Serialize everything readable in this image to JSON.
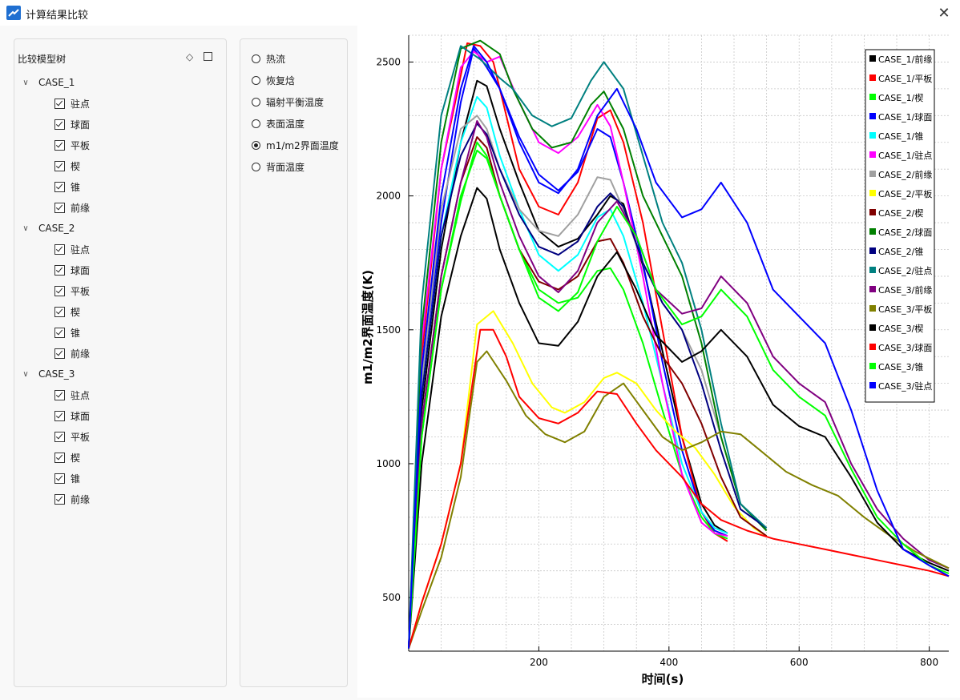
{
  "window": {
    "title": "计算结果比较",
    "close_glyph": "✕"
  },
  "tree": {
    "header": "比较模型树",
    "cases": [
      {
        "name": "CASE_1",
        "items": [
          "驻点",
          "球面",
          "平板",
          "楔",
          "锥",
          "前缘"
        ]
      },
      {
        "name": "CASE_2",
        "items": [
          "驻点",
          "球面",
          "平板",
          "楔",
          "锥",
          "前缘"
        ]
      },
      {
        "name": "CASE_3",
        "items": [
          "驻点",
          "球面",
          "平板",
          "楔",
          "锥",
          "前缘"
        ]
      }
    ]
  },
  "quantities": {
    "options": [
      "热流",
      "恢复焓",
      "辐射平衡温度",
      "表面温度",
      "m1/m2界面温度",
      "背面温度"
    ],
    "selected_index": 4
  },
  "chart_data": {
    "type": "line",
    "xlabel": "时间(s)",
    "ylabel": "m1/m2界面温度(K)",
    "xlim": [
      0,
      830
    ],
    "ylim": [
      300,
      2600
    ],
    "xticks": [
      200,
      400,
      600,
      800
    ],
    "yticks": [
      500,
      1000,
      1500,
      2000,
      2500
    ],
    "grid": true,
    "legend_position": "top-right",
    "series": [
      {
        "name": "CASE_1/前缘",
        "color": "#000000",
        "x": [
          0,
          20,
          50,
          80,
          105,
          120,
          140,
          170,
          200,
          230,
          260,
          290,
          310,
          330,
          360,
          390,
          420,
          450,
          470,
          490
        ],
        "y": [
          310,
          1200,
          1800,
          2200,
          2430,
          2410,
          2250,
          2050,
          1870,
          1810,
          1840,
          1930,
          2000,
          1970,
          1740,
          1420,
          1100,
          850,
          770,
          740
        ]
      },
      {
        "name": "CASE_1/平板",
        "color": "#ff0000",
        "x": [
          0,
          20,
          50,
          80,
          90,
          110,
          130,
          150,
          170,
          200,
          230,
          260,
          290,
          310,
          330,
          360,
          390,
          420,
          450,
          470,
          490
        ],
        "y": [
          310,
          1400,
          2100,
          2450,
          2570,
          2560,
          2500,
          2300,
          2100,
          1960,
          1930,
          2050,
          2290,
          2320,
          2200,
          1900,
          1500,
          1100,
          820,
          740,
          710
        ]
      },
      {
        "name": "CASE_1/楔",
        "color": "#00ff00",
        "x": [
          0,
          20,
          50,
          80,
          105,
          120,
          140,
          170,
          200,
          230,
          260,
          290,
          310,
          330,
          360,
          390,
          420,
          450,
          470,
          490
        ],
        "y": [
          310,
          1100,
          1650,
          2000,
          2170,
          2140,
          2000,
          1800,
          1650,
          1600,
          1620,
          1720,
          1730,
          1650,
          1450,
          1200,
          960,
          800,
          740,
          720
        ]
      },
      {
        "name": "CASE_1/球面",
        "color": "#0000ff",
        "x": [
          0,
          20,
          50,
          80,
          100,
          120,
          140,
          170,
          200,
          230,
          260,
          290,
          310,
          330,
          360,
          390,
          420,
          450,
          470,
          490
        ],
        "y": [
          310,
          1300,
          1900,
          2350,
          2550,
          2480,
          2400,
          2220,
          2080,
          2020,
          2090,
          2250,
          2220,
          2050,
          1750,
          1380,
          1050,
          820,
          750,
          730
        ]
      },
      {
        "name": "CASE_1/锥",
        "color": "#00ffff",
        "x": [
          0,
          20,
          50,
          80,
          105,
          120,
          140,
          170,
          200,
          230,
          260,
          290,
          310,
          330,
          360,
          390,
          420,
          450,
          470,
          490
        ],
        "y": [
          310,
          1250,
          1850,
          2200,
          2370,
          2330,
          2150,
          1950,
          1780,
          1720,
          1780,
          1920,
          1950,
          1850,
          1600,
          1300,
          1000,
          820,
          760,
          740
        ]
      },
      {
        "name": "CASE_1/驻点",
        "color": "#ff00ff",
        "x": [
          0,
          20,
          50,
          80,
          100,
          120,
          140,
          170,
          200,
          230,
          260,
          290,
          310,
          330,
          360,
          390,
          420,
          450,
          470,
          490
        ],
        "y": [
          310,
          1450,
          2100,
          2480,
          2540,
          2500,
          2520,
          2350,
          2200,
          2160,
          2220,
          2340,
          2260,
          2050,
          1700,
          1300,
          960,
          780,
          740,
          730
        ]
      },
      {
        "name": "CASE_2/前缘",
        "color": "#a0a0a0",
        "x": [
          0,
          20,
          50,
          80,
          105,
          120,
          140,
          170,
          200,
          230,
          260,
          290,
          310,
          330,
          360,
          390,
          420,
          450,
          480,
          510,
          550
        ],
        "y": [
          310,
          1300,
          1950,
          2250,
          2300,
          2250,
          2100,
          1950,
          1870,
          1850,
          1930,
          2070,
          2060,
          1950,
          1750,
          1600,
          1500,
          1350,
          1100,
          850,
          750
        ]
      },
      {
        "name": "CASE_2/平板",
        "color": "#ffff00",
        "x": [
          0,
          20,
          50,
          80,
          105,
          130,
          160,
          190,
          220,
          240,
          270,
          300,
          320,
          350,
          380,
          410,
          440,
          470,
          500,
          530,
          550
        ],
        "y": [
          310,
          480,
          700,
          1000,
          1520,
          1570,
          1450,
          1300,
          1210,
          1190,
          1230,
          1320,
          1340,
          1300,
          1200,
          1120,
          1060,
          960,
          840,
          760,
          730
        ]
      },
      {
        "name": "CASE_2/楔",
        "color": "#800000",
        "x": [
          0,
          20,
          50,
          80,
          105,
          120,
          140,
          170,
          200,
          230,
          260,
          290,
          310,
          330,
          360,
          390,
          420,
          450,
          480,
          510,
          550
        ],
        "y": [
          310,
          1150,
          1700,
          2050,
          2220,
          2180,
          2000,
          1800,
          1680,
          1650,
          1700,
          1830,
          1840,
          1750,
          1550,
          1400,
          1300,
          1150,
          950,
          800,
          730
        ]
      },
      {
        "name": "CASE_2/球面",
        "color": "#008000",
        "x": [
          0,
          20,
          50,
          80,
          110,
          140,
          160,
          190,
          220,
          250,
          280,
          300,
          330,
          360,
          390,
          420,
          450,
          480,
          510,
          550
        ],
        "y": [
          310,
          1500,
          2200,
          2550,
          2580,
          2530,
          2400,
          2250,
          2180,
          2200,
          2340,
          2390,
          2250,
          2000,
          1850,
          1700,
          1450,
          1100,
          850,
          750
        ]
      },
      {
        "name": "CASE_2/锥",
        "color": "#000080",
        "x": [
          0,
          20,
          50,
          80,
          105,
          120,
          140,
          170,
          200,
          230,
          260,
          290,
          310,
          330,
          360,
          390,
          420,
          450,
          480,
          510,
          550
        ],
        "y": [
          310,
          1250,
          1850,
          2150,
          2270,
          2230,
          2100,
          1930,
          1810,
          1780,
          1830,
          1960,
          2010,
          1960,
          1750,
          1600,
          1500,
          1300,
          1050,
          830,
          760
        ]
      },
      {
        "name": "CASE_2/驻点",
        "color": "#008080",
        "x": [
          0,
          20,
          50,
          80,
          110,
          140,
          160,
          190,
          220,
          250,
          280,
          300,
          330,
          360,
          390,
          420,
          450,
          480,
          510,
          550
        ],
        "y": [
          310,
          1600,
          2300,
          2560,
          2510,
          2440,
          2400,
          2300,
          2260,
          2290,
          2430,
          2500,
          2400,
          2150,
          1900,
          1750,
          1500,
          1150,
          850,
          760
        ]
      },
      {
        "name": "CASE_3/前缘",
        "color": "#800080",
        "x": [
          0,
          20,
          50,
          80,
          105,
          120,
          140,
          170,
          200,
          230,
          260,
          290,
          320,
          350,
          380,
          420,
          450,
          480,
          520,
          560,
          600,
          640,
          680,
          720,
          760,
          800,
          830
        ],
        "y": [
          310,
          1150,
          1700,
          2050,
          2280,
          2220,
          2050,
          1850,
          1700,
          1640,
          1720,
          1900,
          1980,
          1850,
          1650,
          1560,
          1580,
          1700,
          1600,
          1400,
          1300,
          1230,
          1000,
          830,
          720,
          640,
          610
        ]
      },
      {
        "name": "CASE_3/平板",
        "color": "#808000",
        "x": [
          0,
          20,
          50,
          80,
          105,
          120,
          150,
          180,
          210,
          240,
          270,
          300,
          330,
          360,
          390,
          420,
          450,
          480,
          510,
          540,
          580,
          620,
          660,
          700,
          740,
          780,
          830
        ],
        "y": [
          310,
          450,
          650,
          950,
          1380,
          1420,
          1310,
          1180,
          1110,
          1080,
          1120,
          1250,
          1300,
          1200,
          1100,
          1050,
          1080,
          1120,
          1110,
          1050,
          970,
          920,
          880,
          800,
          730,
          670,
          610
        ]
      },
      {
        "name": "CASE_3/楔",
        "color": "#000000",
        "x": [
          0,
          20,
          50,
          80,
          105,
          120,
          140,
          170,
          200,
          230,
          260,
          290,
          320,
          350,
          380,
          420,
          450,
          480,
          520,
          560,
          600,
          640,
          680,
          720,
          760,
          800,
          830
        ],
        "y": [
          310,
          1000,
          1550,
          1850,
          2030,
          1990,
          1800,
          1600,
          1450,
          1440,
          1530,
          1700,
          1790,
          1650,
          1480,
          1380,
          1420,
          1500,
          1400,
          1220,
          1140,
          1100,
          950,
          780,
          680,
          630,
          600
        ]
      },
      {
        "name": "CASE_3/球面",
        "color": "#ff0000",
        "x": [
          0,
          20,
          50,
          80,
          110,
          130,
          150,
          170,
          200,
          230,
          260,
          290,
          320,
          350,
          380,
          420,
          450,
          480,
          520,
          560,
          600,
          640,
          680,
          720,
          760,
          800,
          830
        ],
        "y": [
          310,
          480,
          700,
          1000,
          1500,
          1500,
          1400,
          1250,
          1170,
          1150,
          1190,
          1270,
          1260,
          1150,
          1050,
          950,
          850,
          790,
          750,
          720,
          700,
          680,
          660,
          640,
          620,
          600,
          580
        ]
      },
      {
        "name": "CASE_3/锥",
        "color": "#00ff00",
        "x": [
          0,
          20,
          50,
          80,
          105,
          120,
          140,
          170,
          200,
          230,
          260,
          290,
          320,
          350,
          380,
          420,
          450,
          480,
          520,
          560,
          600,
          640,
          680,
          720,
          760,
          800,
          830
        ],
        "y": [
          310,
          1100,
          1650,
          1980,
          2200,
          2150,
          2000,
          1800,
          1620,
          1570,
          1640,
          1830,
          1960,
          1850,
          1650,
          1520,
          1550,
          1650,
          1550,
          1350,
          1250,
          1180,
          980,
          800,
          700,
          620,
          590
        ]
      },
      {
        "name": "CASE_3/驻点",
        "color": "#0000ff",
        "x": [
          0,
          20,
          50,
          80,
          100,
          120,
          140,
          170,
          200,
          230,
          260,
          290,
          320,
          350,
          380,
          420,
          450,
          480,
          520,
          560,
          600,
          640,
          680,
          720,
          760,
          800,
          830
        ],
        "y": [
          310,
          1350,
          2000,
          2400,
          2560,
          2500,
          2400,
          2200,
          2050,
          2010,
          2100,
          2300,
          2400,
          2250,
          2050,
          1920,
          1950,
          2050,
          1900,
          1650,
          1550,
          1450,
          1200,
          900,
          680,
          620,
          580
        ]
      }
    ]
  }
}
